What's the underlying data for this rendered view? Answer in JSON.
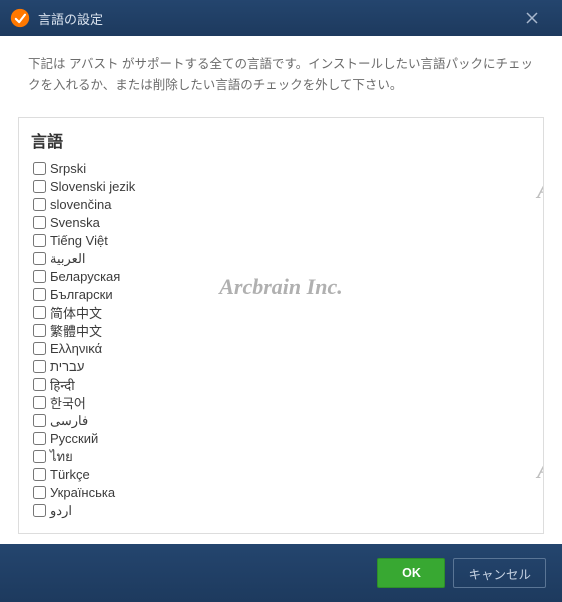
{
  "titlebar": {
    "title": "言語の設定"
  },
  "instructions": "下記は アバスト がサポートする全ての言語です。インストールしたい言語パックにチェックを入れるか、または削除したい言語のチェックを外して下さい。",
  "panel": {
    "header": "言語"
  },
  "languages": [
    {
      "label": "Srpski",
      "checked": false
    },
    {
      "label": "Slovenski jezik",
      "checked": false
    },
    {
      "label": "slovenčina",
      "checked": false
    },
    {
      "label": "Svenska",
      "checked": false
    },
    {
      "label": "Tiếng Việt",
      "checked": false
    },
    {
      "label": "العربية",
      "checked": false,
      "rtl": true
    },
    {
      "label": "Беларуская",
      "checked": false
    },
    {
      "label": "Български",
      "checked": false
    },
    {
      "label": "简体中文",
      "checked": false
    },
    {
      "label": "繁體中文",
      "checked": false
    },
    {
      "label": "Ελληνικά",
      "checked": false
    },
    {
      "label": "עברית",
      "checked": false,
      "rtl": true
    },
    {
      "label": "हिन्दी",
      "checked": false
    },
    {
      "label": "한국어",
      "checked": false
    },
    {
      "label": "فارسی",
      "checked": false,
      "rtl": true
    },
    {
      "label": "Русский",
      "checked": false
    },
    {
      "label": "ไทย",
      "checked": false
    },
    {
      "label": "Türkçe",
      "checked": false
    },
    {
      "label": "Українська",
      "checked": false
    },
    {
      "label": "اردو",
      "checked": false,
      "rtl": true
    }
  ],
  "footer": {
    "ok": "OK",
    "cancel": "キャンセル"
  },
  "watermark": "Arcbrain Inc.",
  "edge_a": "A"
}
